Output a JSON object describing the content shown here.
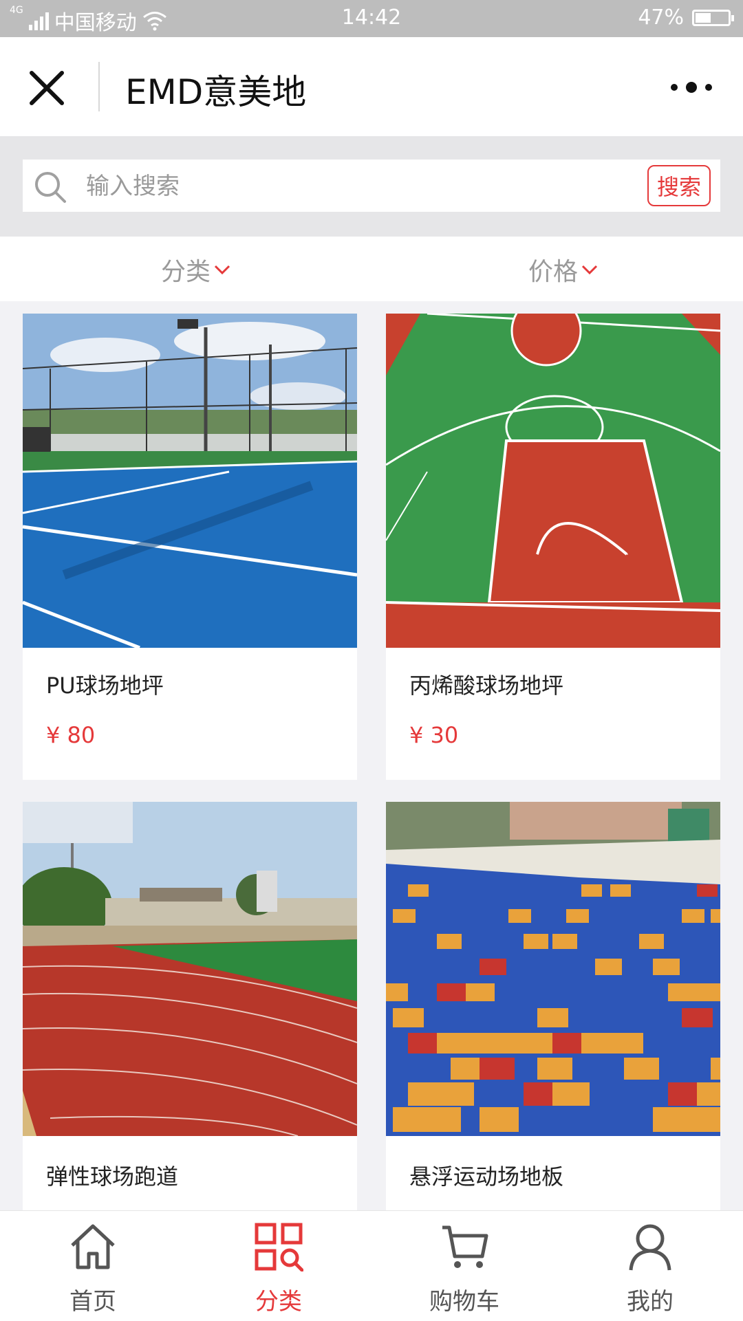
{
  "status_bar": {
    "network": "4G",
    "carrier": "中国移动",
    "time": "14:42",
    "battery": "47%",
    "battery_level": 0.47
  },
  "navbar": {
    "title": "EMD意美地",
    "close_icon": "close-icon",
    "more_icon": "more-icon"
  },
  "search": {
    "placeholder": "输入搜索",
    "button_label": "搜索"
  },
  "filters": [
    {
      "label": "分类"
    },
    {
      "label": "价格"
    }
  ],
  "products": [
    {
      "name": "PU球场地坪",
      "price": "¥ 80"
    },
    {
      "name": "丙烯酸球场地坪",
      "price": "¥ 30"
    },
    {
      "name": "弹性球场跑道",
      "price": ""
    },
    {
      "name": "悬浮运动场地板",
      "price": ""
    }
  ],
  "tabs": [
    {
      "label": "首页",
      "icon": "home-icon",
      "active": false
    },
    {
      "label": "分类",
      "icon": "category-icon",
      "active": true
    },
    {
      "label": "购物车",
      "icon": "cart-icon",
      "active": false
    },
    {
      "label": "我的",
      "icon": "user-icon",
      "active": false
    }
  ],
  "colors": {
    "accent": "#e5393a",
    "status_bar_bg": "#bdbdbd",
    "page_bg": "#f2f2f5"
  }
}
